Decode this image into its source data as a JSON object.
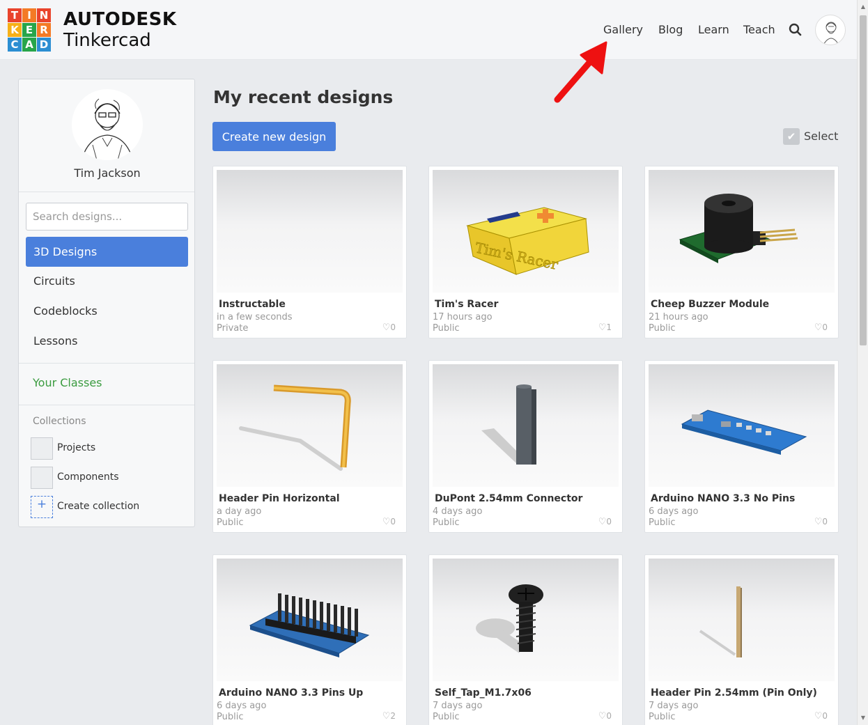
{
  "header": {
    "logo_letters": [
      "T",
      "I",
      "N",
      "K",
      "E",
      "R",
      "C",
      "A",
      "D"
    ],
    "logo_colors": [
      "#e9432c",
      "#f47a25",
      "#e9432c",
      "#f7b018",
      "#27a54a",
      "#f47a25",
      "#2b8ed2",
      "#27a54a",
      "#2b8ed2"
    ],
    "brand_top": "AUTODESK",
    "brand_bottom": "Tinkercad",
    "nav": {
      "gallery": "Gallery",
      "blog": "Blog",
      "learn": "Learn",
      "teach": "Teach"
    }
  },
  "sidebar": {
    "user_name": "Tim Jackson",
    "search_placeholder": "Search designs...",
    "items": [
      {
        "label": "3D Designs",
        "active": true
      },
      {
        "label": "Circuits"
      },
      {
        "label": "Codeblocks"
      },
      {
        "label": "Lessons"
      }
    ],
    "classes_label": "Your Classes",
    "collections_label": "Collections",
    "collections": [
      "Projects",
      "Components"
    ],
    "create_collection": "Create collection"
  },
  "main": {
    "title": "My recent designs",
    "create_button": "Create new design",
    "select_label": "Select",
    "designs": [
      {
        "title": "Instructable",
        "time": "in a few seconds",
        "visibility": "Private",
        "likes": "0"
      },
      {
        "title": "Tim's Racer",
        "time": "17 hours ago",
        "visibility": "Public",
        "likes": "1"
      },
      {
        "title": "Cheep Buzzer Module",
        "time": "21 hours ago",
        "visibility": "Public",
        "likes": "0"
      },
      {
        "title": "Header Pin Horizontal",
        "time": "a day ago",
        "visibility": "Public",
        "likes": "0"
      },
      {
        "title": "DuPont 2.54mm Connector",
        "time": "4 days ago",
        "visibility": "Public",
        "likes": "0"
      },
      {
        "title": "Arduino NANO 3.3 No Pins",
        "time": "6 days ago",
        "visibility": "Public",
        "likes": "0"
      },
      {
        "title": "Arduino NANO 3.3 Pins Up",
        "time": "6 days ago",
        "visibility": "Public",
        "likes": "2"
      },
      {
        "title": "Self_Tap_M1.7x06",
        "time": "7 days ago",
        "visibility": "Public",
        "likes": "0"
      },
      {
        "title": "Header Pin 2.54mm (Pin Only)",
        "time": "7 days ago",
        "visibility": "Public",
        "likes": "0"
      }
    ],
    "racer_text": "Tim's Racer"
  },
  "colors": {
    "accent": "#4a7fdc",
    "classes": "#3a9b3f",
    "arrow": "#ee1111"
  }
}
